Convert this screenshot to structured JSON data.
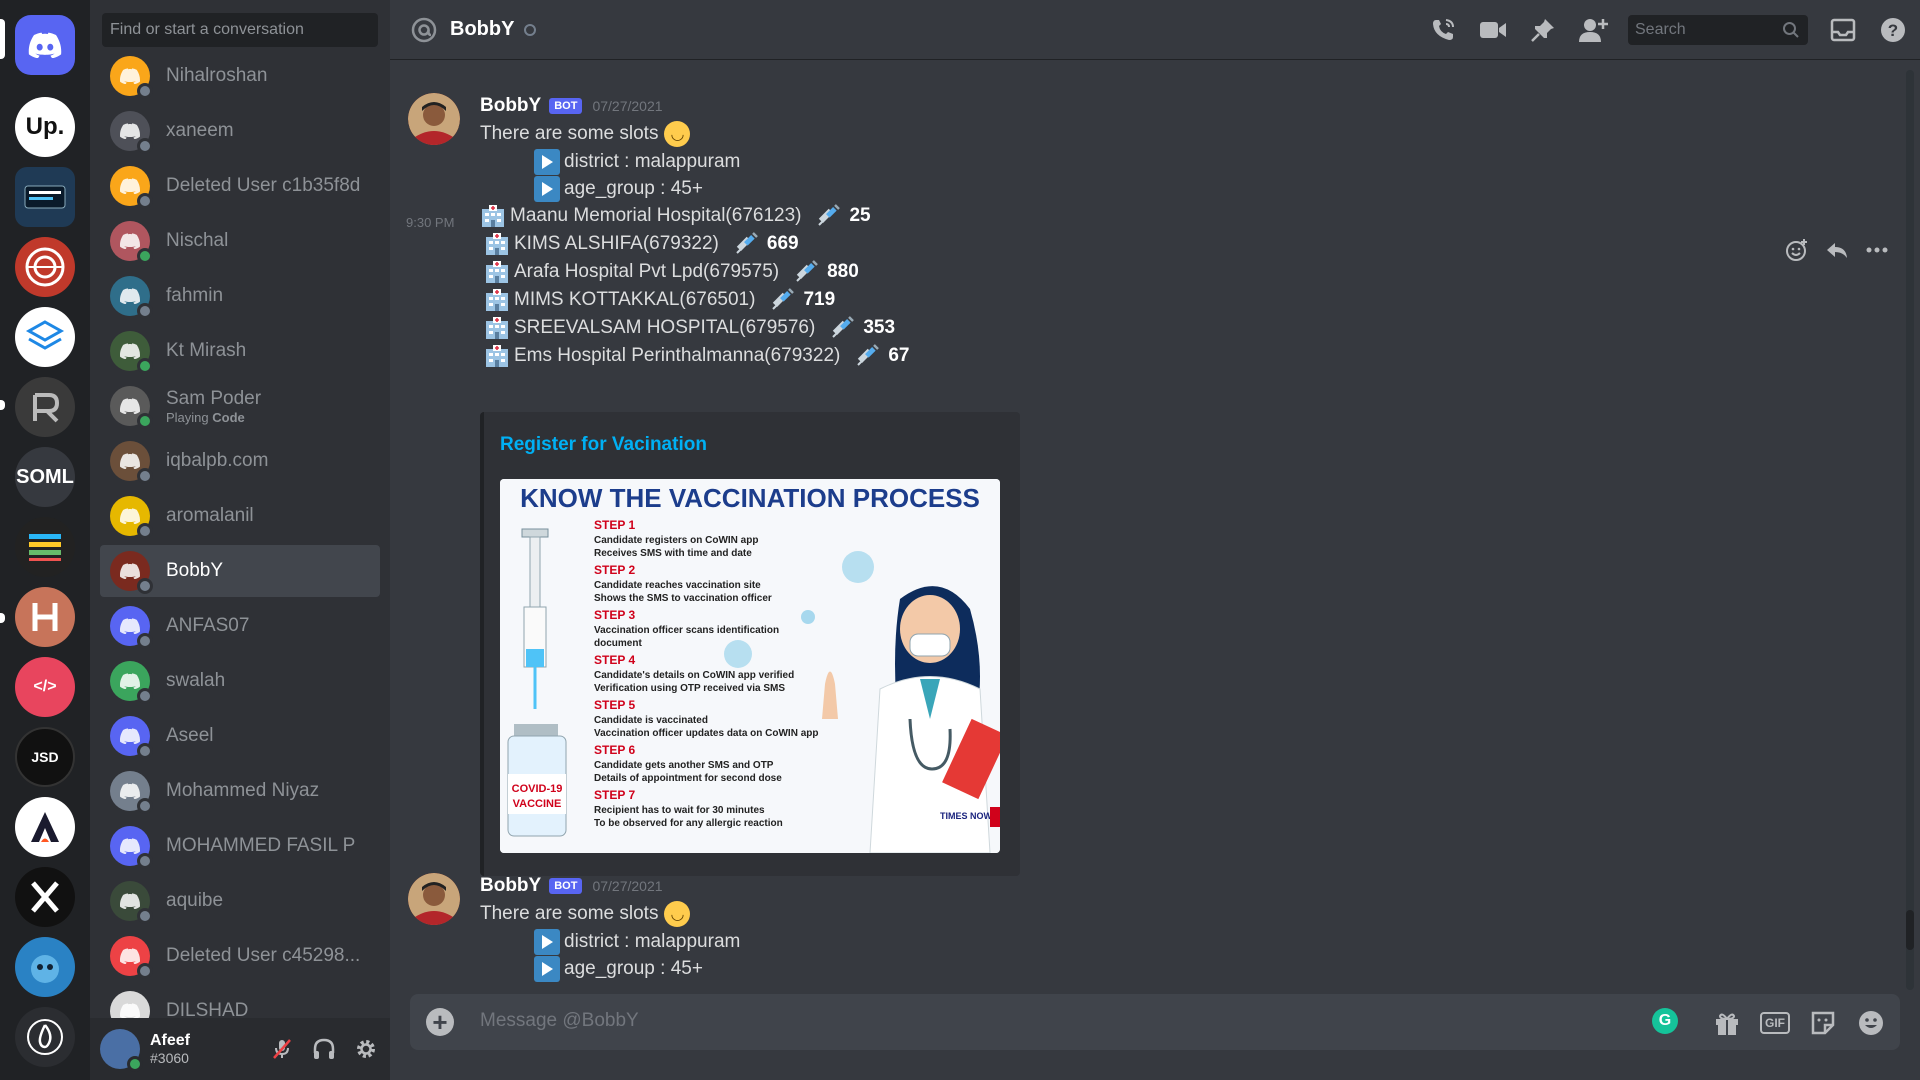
{
  "servers": [
    {
      "label": "",
      "color": "#5865f2",
      "icon": "discord-logo-icon"
    },
    {
      "label": "Up.",
      "color": "#ffffff",
      "text_color": "#111111"
    },
    {
      "label": "",
      "color": "#1f3a55",
      "icon": "built-in-flutter-icon"
    },
    {
      "label": "",
      "color": "#c0392b",
      "icon": "spiral-logo-icon"
    },
    {
      "label": "",
      "color": "#ffffff",
      "icon": "cube-logo-icon"
    },
    {
      "label": "",
      "color": "#3a3a3a",
      "icon": "r-logo-icon"
    },
    {
      "label": "SOML",
      "color": "#36393f",
      "text_color": "#ffffff"
    },
    {
      "label": "",
      "color": "#222222",
      "icon": "stack-logo-icon"
    },
    {
      "label": "",
      "color": "#c7745a",
      "icon": "h-logo-icon"
    },
    {
      "label": "</>",
      "color": "#e8455e",
      "text_color": "#ffffff"
    },
    {
      "label": "JSD",
      "color": "#111111",
      "text_color": "#ffffff"
    },
    {
      "label": "",
      "color": "#ffffff",
      "icon": "a-logo-icon"
    },
    {
      "label": "",
      "color": "#111111",
      "icon": "x-logo-icon"
    },
    {
      "label": "",
      "color": "#2a82c4",
      "icon": "mascot-logo-icon"
    },
    {
      "label": "",
      "color": "#2b2d31",
      "icon": "flame-logo-icon"
    }
  ],
  "dm": {
    "search_placeholder": "Find or start a conversation",
    "items": [
      {
        "name": "Nihalroshan",
        "avatar_color": "#faa61a",
        "status": "offline"
      },
      {
        "name": "xaneem",
        "avatar_color": "#4e5058",
        "status": "offline"
      },
      {
        "name": "Deleted User c1b35f8d",
        "avatar_color": "#faa61a",
        "status": "offline"
      },
      {
        "name": "Nischal",
        "avatar_color": "#b0565f",
        "status": "online"
      },
      {
        "name": "fahmin",
        "avatar_color": "#2f6e8a",
        "status": "offline"
      },
      {
        "name": "Kt Mirash",
        "avatar_color": "#3e5c3a",
        "status": "online"
      },
      {
        "name": "Sam Poder",
        "sub": "Playing",
        "sub_bold": "Code",
        "avatar_color": "#5a5a5a",
        "status": "online"
      },
      {
        "name": "iqbalpb.com",
        "avatar_color": "#6b4f3a",
        "status": "offline"
      },
      {
        "name": "aromalanil",
        "avatar_color": "#e6b800",
        "status": "offline"
      },
      {
        "name": "BobbY",
        "avatar_color": "#7a2a1f",
        "status": "offline",
        "active": true
      },
      {
        "name": "ANFAS07",
        "avatar_color": "#5865f2",
        "status": "offline"
      },
      {
        "name": "swalah",
        "avatar_color": "#3ba55d",
        "status": "offline"
      },
      {
        "name": "Aseel",
        "avatar_color": "#5865f2",
        "status": "offline"
      },
      {
        "name": "Mohammed Niyaz",
        "avatar_color": "#747f8d",
        "status": "offline"
      },
      {
        "name": "MOHAMMED FASIL P",
        "avatar_color": "#5865f2",
        "status": "offline"
      },
      {
        "name": "aquibe",
        "avatar_color": "#3a4a3a",
        "status": "offline"
      },
      {
        "name": "Deleted User c45298...",
        "avatar_color": "#ed4245",
        "status": "offline"
      },
      {
        "name": "DILSHAD",
        "avatar_color": "#d9d9d9",
        "status": "offline"
      }
    ]
  },
  "user": {
    "name": "Afeef",
    "tag": "#3060"
  },
  "header": {
    "title": "BobbY",
    "search_placeholder": "Search"
  },
  "messages": [
    {
      "author": "BobbY",
      "bot_label": "BOT",
      "date": "07/27/2021",
      "intro": "There are some slots",
      "district": "district : malappuram",
      "age_group": "age_group : 45+",
      "timestamp": "9:30 PM",
      "hospitals": [
        {
          "name": "Maanu Memorial Hospital(676123)",
          "count": "25"
        },
        {
          "name": "KIMS ALSHIFA(679322)",
          "count": "669"
        },
        {
          "name": "Arafa Hospital Pvt Lpd(679575)",
          "count": "880"
        },
        {
          "name": "MIMS KOTTAKKAL(676501)",
          "count": "719"
        },
        {
          "name": "SREEVALSAM HOSPITAL(679576)",
          "count": "353"
        },
        {
          "name": "Ems Hospital Perinthalmanna(679322)",
          "count": "67"
        }
      ],
      "embed": {
        "title": "Register for Vacination",
        "image": {
          "heading": "KNOW THE VACCINATION PROCESS",
          "steps": [
            {
              "label": "STEP 1",
              "lines": [
                "Candidate registers on CoWIN app",
                "Receives SMS with time and date"
              ]
            },
            {
              "label": "STEP 2",
              "lines": [
                "Candidate reaches vaccination site",
                "Shows the SMS to vaccination officer"
              ]
            },
            {
              "label": "STEP 3",
              "lines": [
                "Vaccination officer scans identification",
                "document"
              ]
            },
            {
              "label": "STEP 4",
              "lines": [
                "Candidate's details on CoWIN app verified",
                "Verification using OTP received via SMS"
              ]
            },
            {
              "label": "STEP 5",
              "lines": [
                "Candidate is vaccinated",
                "Vaccination officer updates data on CoWIN app"
              ]
            },
            {
              "label": "STEP 6",
              "lines": [
                "Candidate gets another SMS and OTP",
                "Details of appointment for second dose"
              ]
            },
            {
              "label": "STEP 7",
              "lines": [
                "Recipient has to wait for 30 minutes",
                "To be observed for any allergic reaction"
              ]
            }
          ],
          "vial_label_1": "COVID-19",
          "vial_label_2": "VACCINE",
          "brand": "TIMES NOW"
        }
      }
    },
    {
      "author": "BobbY",
      "bot_label": "BOT",
      "date": "07/27/2021",
      "intro": "There are some slots",
      "district": "district : malappuram",
      "age_group": "age_group : 45+"
    }
  ],
  "composer": {
    "placeholder": "Message @BobbY",
    "gif_label": "GIF"
  },
  "colors": {
    "accent": "#5865f2",
    "link": "#00b0f4",
    "online": "#3ba55d",
    "step_red": "#d0021b",
    "heading_blue": "#1c3d8c"
  }
}
